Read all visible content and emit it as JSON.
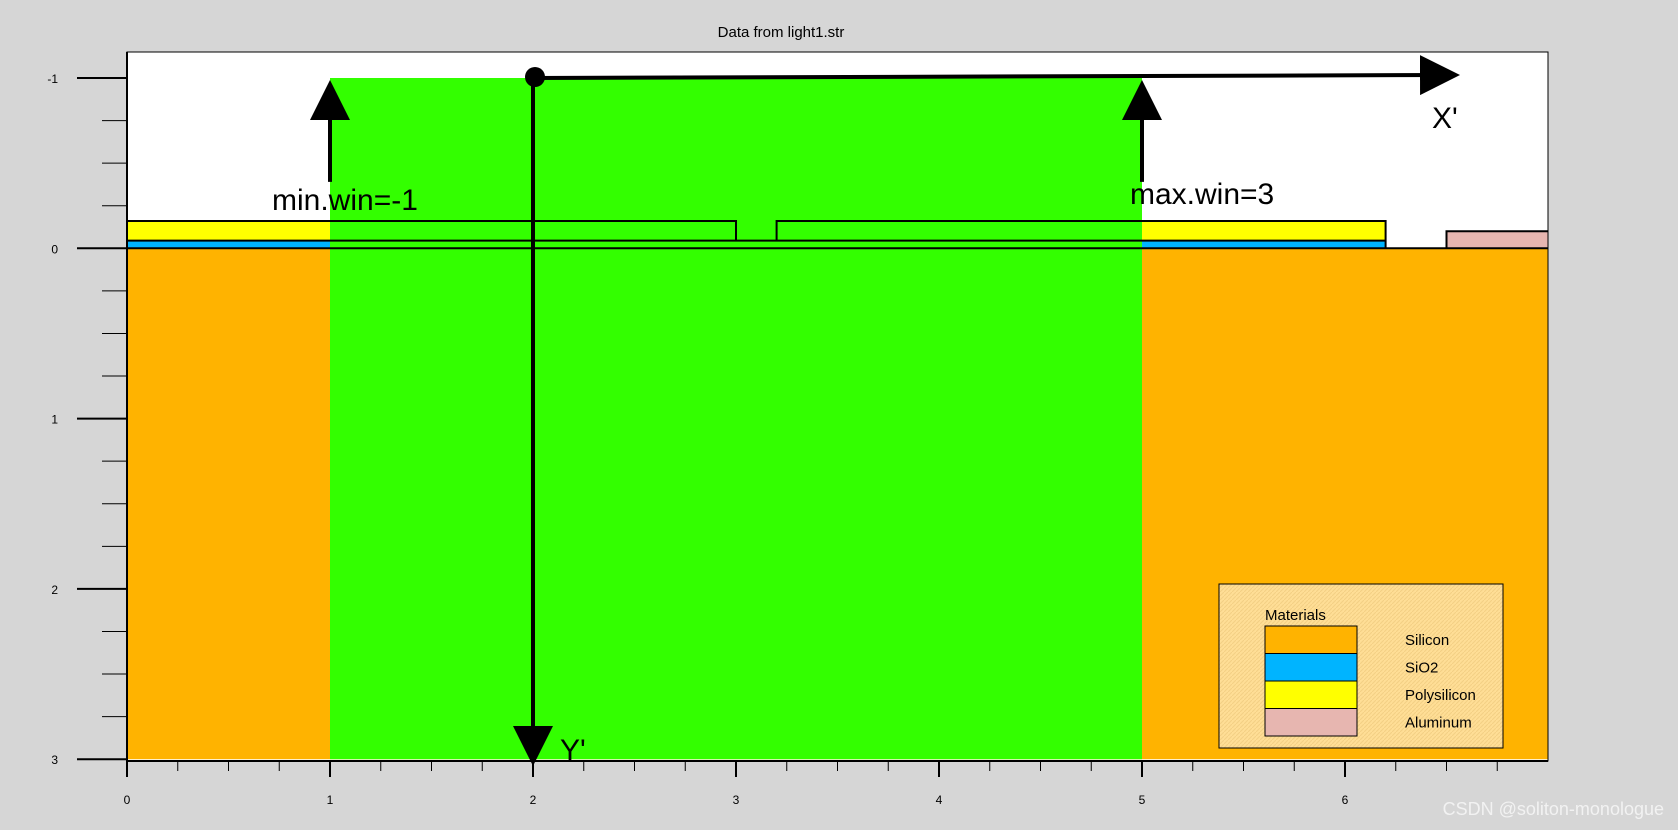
{
  "chart_data": {
    "type": "diagram",
    "title": "Data from light1.str",
    "x_ticks": [
      "0",
      "1",
      "2",
      "3",
      "4",
      "5",
      "6"
    ],
    "y_ticks": [
      "-1",
      "0",
      "1",
      "2",
      "3"
    ],
    "x_range": [
      0,
      7
    ],
    "y_range": [
      -1.1,
      3
    ],
    "regions": [
      {
        "material": "Silicon",
        "x": [
          0,
          7
        ],
        "y": [
          0,
          3
        ]
      },
      {
        "material": "SiO2",
        "x": [
          0,
          6.2
        ],
        "y": [
          -0.045,
          0
        ]
      },
      {
        "material": "Polysilicon",
        "x": [
          0,
          3.0
        ],
        "y": [
          -0.16,
          -0.045
        ]
      },
      {
        "material": "Polysilicon",
        "x": [
          3.2,
          6.2
        ],
        "y": [
          -0.16,
          -0.045
        ]
      },
      {
        "material": "Aluminum",
        "x": [
          6.5,
          7
        ],
        "y": [
          -0.1,
          0
        ]
      }
    ],
    "highlight_window": {
      "x": [
        1,
        5
      ],
      "y": [
        -1,
        3
      ],
      "color": "#33ff00"
    },
    "annotations": {
      "min_label": "min.win=-1",
      "max_label": "max.win=3",
      "x_axis_label": "X'",
      "y_axis_label": "Y'",
      "origin": {
        "x": 2,
        "y": -1
      }
    },
    "legend": {
      "title": "Materials",
      "position": "bottom-right",
      "items": [
        {
          "name": "Silicon",
          "color": "#ffb300"
        },
        {
          "name": "SiO2",
          "color": "#00b4ff"
        },
        {
          "name": "Polysilicon",
          "color": "#ffff00"
        },
        {
          "name": "Aluminum",
          "color": "#e7b6b0"
        }
      ]
    }
  },
  "watermark": "CSDN @soliton-monologue"
}
